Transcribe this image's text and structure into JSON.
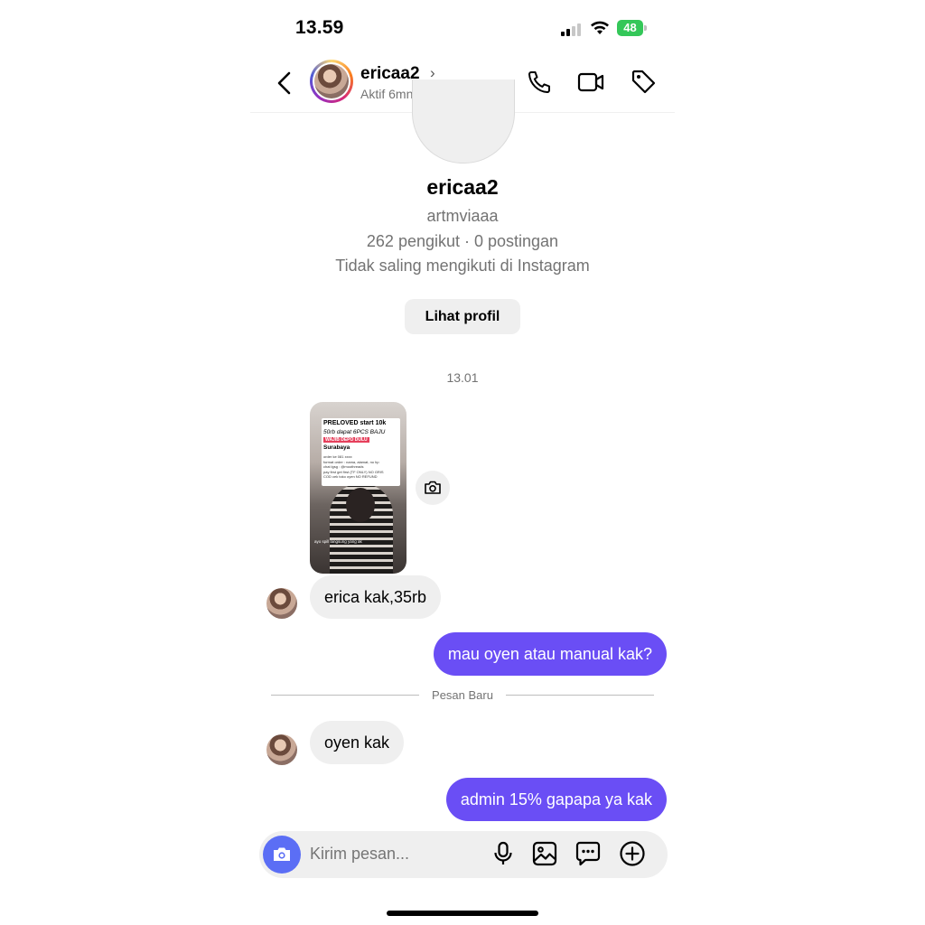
{
  "status_bar": {
    "time": "13.59",
    "battery": "48"
  },
  "header": {
    "username": "ericaa2",
    "activity": "Aktif 6mnt yang lalu"
  },
  "profile": {
    "name": "ericaa2",
    "handle": "artmviaaa",
    "stats": "262 pengikut · 0 postingan",
    "follow_status": "Tidak saling mengikuti di Instagram",
    "view_profile_label": "Lihat profil"
  },
  "timestamp": "13.01",
  "shared_post": {
    "line1": "PRELOVED start 10k",
    "line2": "50rb dapat 6PCS BAJU",
    "line3": "WAJIB DEPO DULU",
    "line4": "Surabaya",
    "line5": "order ke 081 xxxx",
    "line6": "format order : nama, alamat, no hp",
    "line7": "chat lgsg : @moothreads",
    "line8": "pay first get first (TF ONLY) NO GRIS",
    "line9": "COD cek toko oyen NO REFUND",
    "caption": "ayo spill langsung yang ak"
  },
  "messages": [
    {
      "from": "them",
      "text": "erica kak,35rb"
    },
    {
      "from": "me",
      "text": "mau oyen atau manual kak?"
    },
    {
      "from": "them",
      "text": "oyen kak"
    },
    {
      "from": "me",
      "text": "admin 15% gapapa ya kak"
    }
  ],
  "divider_label": "Pesan Baru",
  "composer": {
    "placeholder": "Kirim pesan..."
  },
  "colors": {
    "outgoing_bubble": "#6a4ef5",
    "camera_button": "#5b6ef5",
    "incoming_bubble": "#efefef"
  }
}
